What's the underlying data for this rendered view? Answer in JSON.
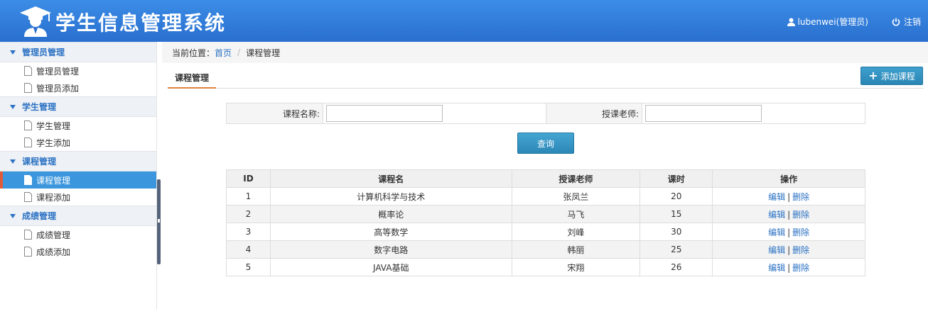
{
  "header": {
    "title": "学生信息管理系统",
    "user": "lubenwei(管理员)",
    "logout": "注销",
    "logo_icon": "graduate-user-icon",
    "brand_color": "#2a6fcf"
  },
  "sidebar": {
    "groups": [
      {
        "label": "管理员管理",
        "items": [
          "管理员管理",
          "管理员添加"
        ]
      },
      {
        "label": "学生管理",
        "items": [
          "学生管理",
          "学生添加"
        ]
      },
      {
        "label": "课程管理",
        "items": [
          "课程管理",
          "课程添加"
        ]
      },
      {
        "label": "成绩管理",
        "items": [
          "成绩管理",
          "成绩添加"
        ]
      }
    ],
    "active_item": "课程管理"
  },
  "breadcrumb": {
    "prefix": "当前位置：",
    "home": "首页",
    "current": "课程管理"
  },
  "tab": {
    "label": "课程管理",
    "add_label": "添加课程"
  },
  "search": {
    "course_label": "课程名称:",
    "course_value": "",
    "teacher_label": "授课老师:",
    "teacher_value": "",
    "query_label": "查询"
  },
  "table": {
    "headers": [
      "ID",
      "课程名",
      "授课老师",
      "课时",
      "操作"
    ],
    "rows": [
      [
        "1",
        "计算机科学与技术",
        "张凤兰",
        "20"
      ],
      [
        "2",
        "概率论",
        "马飞",
        "15"
      ],
      [
        "3",
        "高等数学",
        "刘峰",
        "30"
      ],
      [
        "4",
        "数字电路",
        "韩丽",
        "25"
      ],
      [
        "5",
        "JAVA基础",
        "宋翔",
        "26"
      ]
    ],
    "edit_label": "编辑",
    "delete_label": "删除",
    "separator": "|"
  }
}
